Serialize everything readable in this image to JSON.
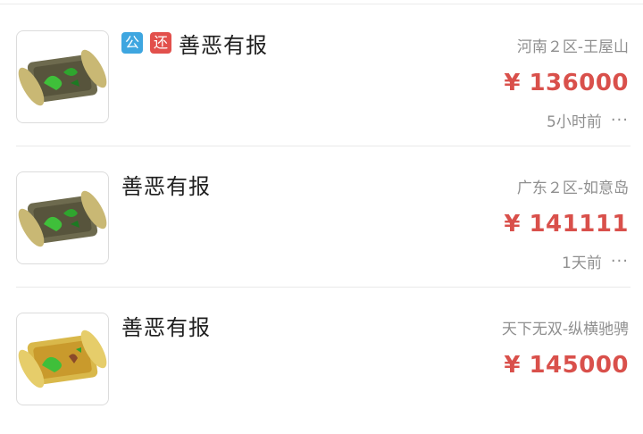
{
  "listings": [
    {
      "badges": [
        "公",
        "还"
      ],
      "title": "善恶有报",
      "server": "河南２区-王屋山",
      "price": "¥ 136000",
      "time": "5小时前",
      "more": "···",
      "scroll_style": "dark"
    },
    {
      "badges": [],
      "title": "善恶有报",
      "server": "广东２区-如意岛",
      "price": "¥ 141111",
      "time": "1天前",
      "more": "···",
      "scroll_style": "dark"
    },
    {
      "badges": [],
      "title": "善恶有报",
      "server": "天下无双-纵横驰骋",
      "price": "¥ 145000",
      "time": "",
      "more": "",
      "scroll_style": "gold"
    }
  ],
  "colors": {
    "price": "#d9504b",
    "badge_public": "#3ea6e0",
    "badge_return": "#e2504c",
    "muted_text": "#8f8f8f"
  },
  "icons": {
    "item_image": "scroll-icon",
    "more": "more-dots-icon"
  }
}
